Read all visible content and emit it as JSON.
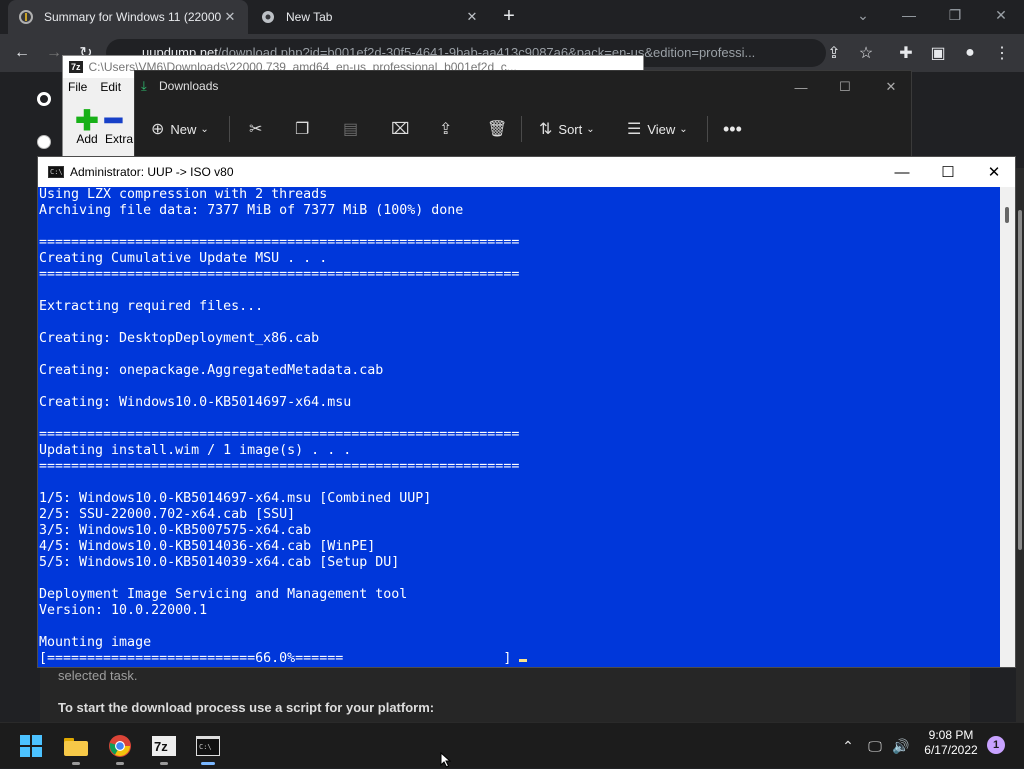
{
  "browser": {
    "tabs": [
      {
        "title": "Summary for Windows 11 (22000",
        "active": true
      },
      {
        "title": "New Tab",
        "active": false
      }
    ],
    "address": {
      "host": "uupdump.net",
      "path": "/download.php?id=b001ef2d-30f5-4641-9bab-aa413c9087a6&pack=en-us&edition=professi..."
    }
  },
  "page": {
    "text1": "selected task.",
    "text2": "To start the download process use a script for your platform:"
  },
  "sevenzip": {
    "title": "C:\\Users\\VM6\\Downloads\\22000.739_amd64_en-us_professional_b001ef2d_c...",
    "menu": [
      "File",
      "Edit"
    ],
    "add_label": "Add",
    "extract_label": "Extra"
  },
  "explorer": {
    "title": "Downloads",
    "new_label": "New",
    "sort_label": "Sort",
    "view_label": "View"
  },
  "console": {
    "title": "Administrator:  UUP -> ISO v80",
    "lines": [
      "Using LZX compression with 2 threads",
      "Archiving file data: 7377 MiB of 7377 MiB (100%) done",
      "",
      "============================================================",
      "Creating Cumulative Update MSU . . .",
      "============================================================",
      "",
      "Extracting required files...",
      "",
      "Creating: DesktopDeployment_x86.cab",
      "",
      "Creating: onepackage.AggregatedMetadata.cab",
      "",
      "Creating: Windows10.0-KB5014697-x64.msu",
      "",
      "============================================================",
      "Updating install.wim / 1 image(s) . . .",
      "============================================================",
      "",
      "1/5: Windows10.0-KB5014697-x64.msu [Combined UUP]",
      "2/5: SSU-22000.702-x64.cab [SSU]",
      "3/5: Windows10.0-KB5007575-x64.cab",
      "4/5: Windows10.0-KB5014036-x64.cab [WinPE]",
      "5/5: Windows10.0-KB5014039-x64.cab [Setup DU]",
      "",
      "Deployment Image Servicing and Management tool",
      "Version: 10.0.22000.1",
      "",
      "Mounting image",
      "[==========================66.0%======                    ] "
    ]
  },
  "taskbar": {
    "time": "9:08 PM",
    "date": "6/17/2022",
    "notification_count": "1",
    "apps": [
      "windows-start",
      "file-explorer",
      "chrome",
      "7-zip",
      "terminal"
    ]
  }
}
